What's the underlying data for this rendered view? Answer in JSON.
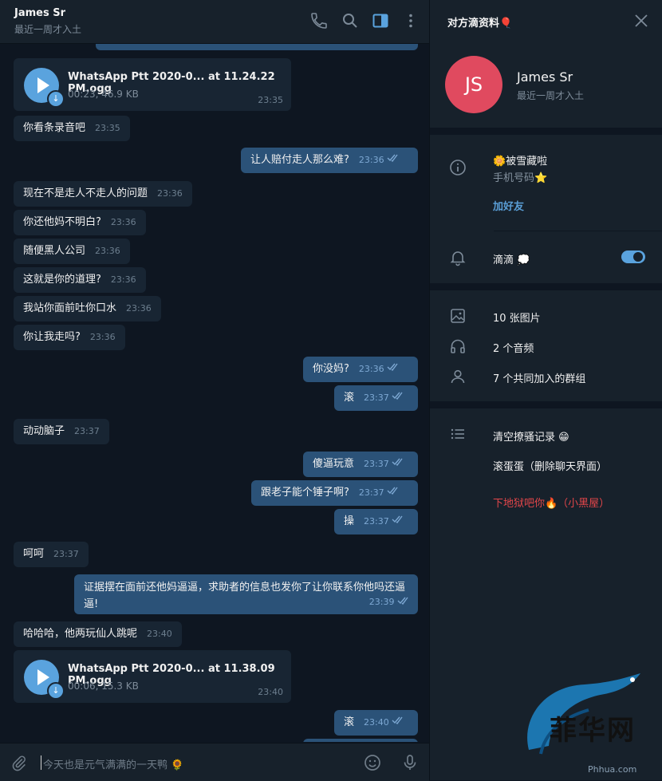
{
  "colors": {
    "accent": "#5aa3de",
    "outgoing_bubble": "#2b5278",
    "incoming_bubble": "#182533",
    "avatar": "#e04a5f",
    "danger": "#e3464a"
  },
  "header": {
    "title": "James Sr",
    "status": "最近一周才入土"
  },
  "messages": [
    {
      "type": "voice",
      "dir": "in",
      "name": "WhatsApp Ptt 2020-0... at 11.24.22 PM.ogg",
      "meta": "00:23, 46.9 KB",
      "time": "23:35"
    },
    {
      "type": "text",
      "dir": "in",
      "text": "你看条录音吧",
      "time": "23:35"
    },
    {
      "type": "text",
      "dir": "out",
      "text": "让人赔付走人那么难?",
      "time": "23:36"
    },
    {
      "type": "text",
      "dir": "in",
      "text": "现在不是走人不走人的问题",
      "time": "23:36"
    },
    {
      "type": "text",
      "dir": "in",
      "text": "你还他妈不明白?",
      "time": "23:36"
    },
    {
      "type": "text",
      "dir": "in",
      "text": "随便黑人公司",
      "time": "23:36"
    },
    {
      "type": "text",
      "dir": "in",
      "text": "这就是你的道理?",
      "time": "23:36"
    },
    {
      "type": "text",
      "dir": "in",
      "text": "我站你面前吐你口水",
      "time": "23:36"
    },
    {
      "type": "text",
      "dir": "in",
      "text": "你让我走吗?",
      "time": "23:36"
    },
    {
      "type": "text",
      "dir": "out",
      "text": "你没妈?",
      "time": "23:36"
    },
    {
      "type": "text",
      "dir": "out",
      "text": "滚",
      "time": "23:37"
    },
    {
      "type": "text",
      "dir": "in",
      "text": "动动脑子",
      "time": "23:37"
    },
    {
      "type": "text",
      "dir": "out",
      "text": "傻逼玩意",
      "time": "23:37"
    },
    {
      "type": "text",
      "dir": "out",
      "text": "跟老子能个锤子啊?",
      "time": "23:37"
    },
    {
      "type": "text",
      "dir": "out",
      "text": "操",
      "time": "23:37"
    },
    {
      "type": "text",
      "dir": "in",
      "text": "呵呵",
      "time": "23:37"
    },
    {
      "type": "multi",
      "dir": "out",
      "line1": "证据摆在面前还他妈逼逼，求助者的信息也发你了让你联系你他吗还逼",
      "line2": "逼!",
      "time": "23:39"
    },
    {
      "type": "text",
      "dir": "in",
      "text": "哈哈哈，他两玩仙人跳呢",
      "time": "23:40"
    },
    {
      "type": "voice",
      "dir": "in",
      "name": "WhatsApp Ptt 2020-0... at 11.38.09 PM.ogg",
      "meta": "00:06, 15.3 KB",
      "time": "23:40"
    },
    {
      "type": "text",
      "dir": "out",
      "text": "滚",
      "time": "23:40"
    }
  ],
  "composer": {
    "placeholder": "今天也是元气满满的一天鸭 🌻"
  },
  "panel": {
    "title": "对方滴资料🎈",
    "avatar_initials": "JS",
    "name": "James Sr",
    "status": "最近一周才入土",
    "bio": "🌼被雪藏啦",
    "phone_label": "手机号码⭐",
    "add_friend": "加好友",
    "notifications": "滴滴 💭",
    "notifications_on": true,
    "photos": "10 张图片",
    "audio": "2 个音频",
    "groups": "7 个共同加入的群组",
    "clear_history": "清空撩骚记录 😁",
    "delete_chat": "滚蛋蛋（删除聊天界面）",
    "block": "下地狱吧你🔥（小黑屋）"
  },
  "watermark": {
    "text": "菲华网",
    "sub": "Phhua.com"
  }
}
